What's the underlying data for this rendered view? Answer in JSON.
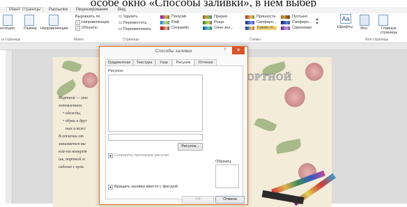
{
  "caption": "особе окно «Способы заливки», в нем выбер",
  "ribbon": {
    "tabs": [
      "Макет страницы",
      "Рассылки",
      "Рецензирование",
      "Вид"
    ],
    "active_tab": "Макет страницы",
    "orientation_label": "ентация",
    "size_label": "Размер",
    "guides_label": "Направляющие",
    "align_label": "Выровнять по",
    "check_guides": "Направляющие",
    "check_objects": "Объекты",
    "delete_label": "Удалить",
    "move_label": "Переместить",
    "rename_label": "Переименовать",
    "scheme_names": [
      "Полугай",
      "Риф",
      "Сельвейн",
      "Прерия",
      "Роща",
      "Сине-зел...",
      "Прянности",
      "Сапфирн...",
      "Синяя гл...",
      "Пустыня",
      "Сапфирн...",
      "Сиреневая"
    ],
    "fonts_label": "Шрифты",
    "bg_label": "Фон",
    "master_label": "Главные страницы",
    "groups": [
      "ы страницы",
      "Макет",
      "Страницы",
      "Схемы",
      "Фон страницы"
    ],
    "accent": "#d8532a"
  },
  "document": {
    "lines": [
      "Портной — это",
      "готовлением",
      "• одежды,",
      "• обуви и друг",
      "ных и кожг",
      "В отличии от",
      "занимается вы",
      "кой-то конкрет",
      "шь, портной м",
      "изделие с нуля."
    ],
    "wordart": "ОРТНОЙ"
  },
  "dialog": {
    "title": "Способы заливки",
    "help": "?",
    "close": "✕",
    "tabs": [
      "Градиентная",
      "Текстура",
      "Узор",
      "Рисунок",
      "Оттенок"
    ],
    "active_tab": "Рисунок",
    "picture_label": "Рисунок:",
    "picture_button": "Рисунок...",
    "keep_ratio": "Сохранять пропорции рисунка",
    "rotate_with_shape": "Вращать заливку вместе с фигурой",
    "sample_label": "Образец:",
    "ok": "ОК",
    "cancel": "Отмена"
  }
}
